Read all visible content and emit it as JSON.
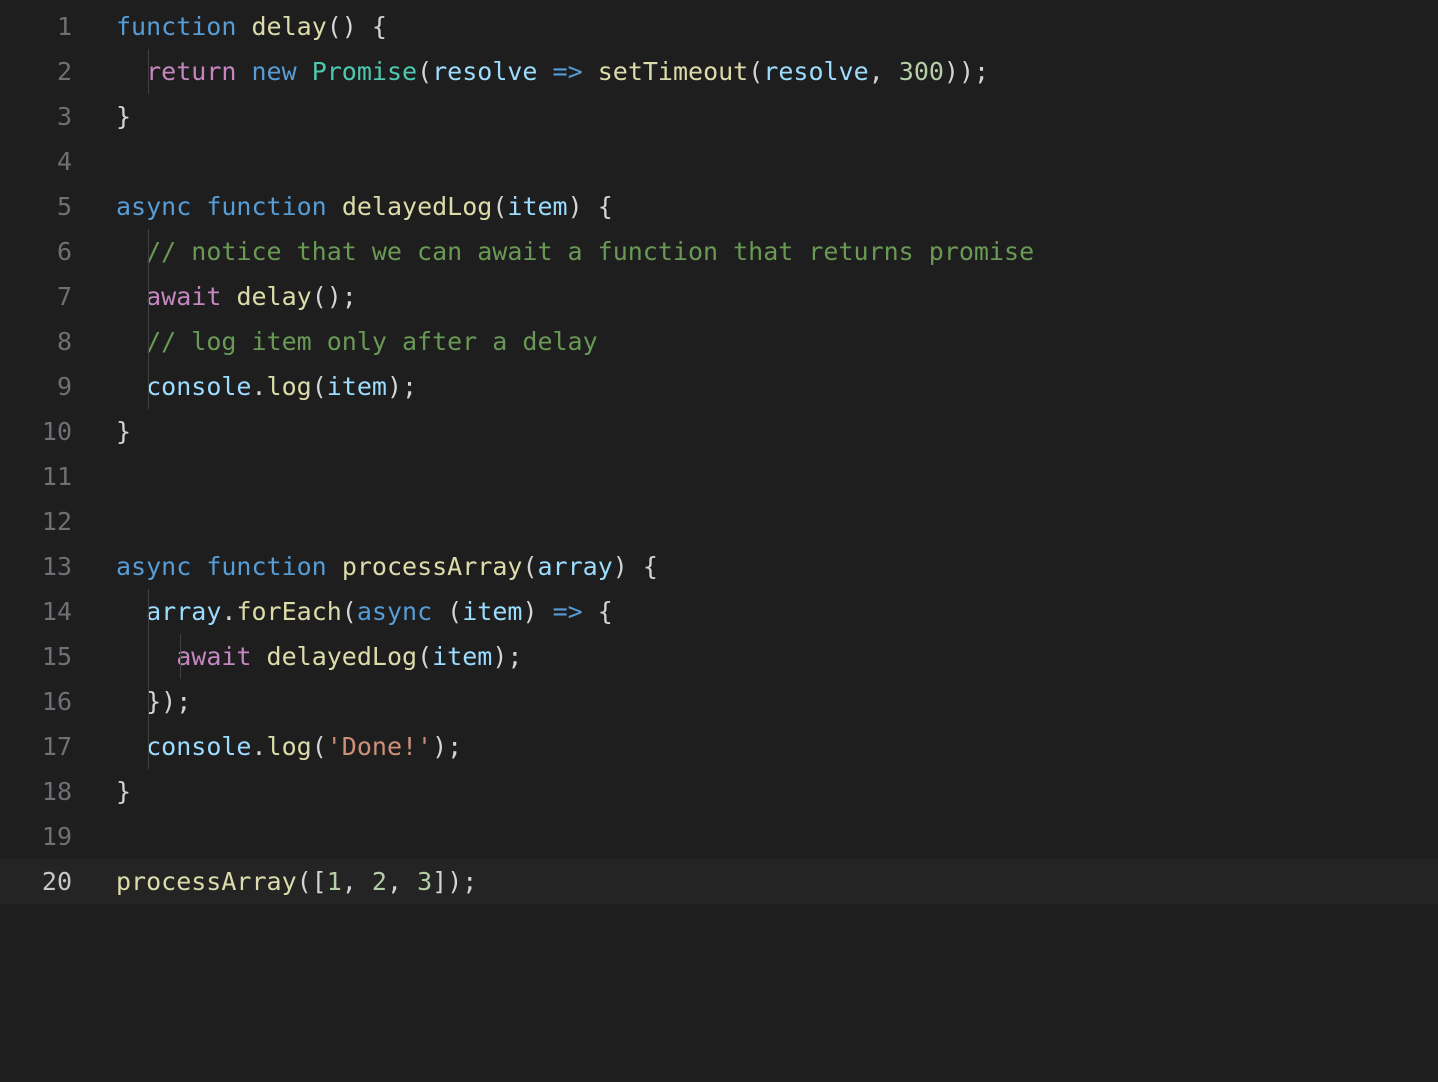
{
  "editor": {
    "activeLine": 20,
    "lines": [
      {
        "n": 1,
        "indent": 0,
        "tokens": [
          [
            "kw",
            "function"
          ],
          [
            "punc",
            " "
          ],
          [
            "fn",
            "delay"
          ],
          [
            "punc",
            "() {"
          ]
        ]
      },
      {
        "n": 2,
        "indent": 1,
        "tokens": [
          [
            "ctrl",
            "return"
          ],
          [
            "punc",
            " "
          ],
          [
            "kw",
            "new"
          ],
          [
            "punc",
            " "
          ],
          [
            "cls",
            "Promise"
          ],
          [
            "punc",
            "("
          ],
          [
            "var",
            "resolve"
          ],
          [
            "punc",
            " "
          ],
          [
            "kw",
            "=>"
          ],
          [
            "punc",
            " "
          ],
          [
            "fn",
            "setTimeout"
          ],
          [
            "punc",
            "("
          ],
          [
            "var",
            "resolve"
          ],
          [
            "punc",
            ", "
          ],
          [
            "num",
            "300"
          ],
          [
            "punc",
            "));"
          ]
        ]
      },
      {
        "n": 3,
        "indent": 0,
        "tokens": [
          [
            "punc",
            "}"
          ]
        ]
      },
      {
        "n": 4,
        "indent": 0,
        "tokens": []
      },
      {
        "n": 5,
        "indent": 0,
        "tokens": [
          [
            "kw",
            "async"
          ],
          [
            "punc",
            " "
          ],
          [
            "kw",
            "function"
          ],
          [
            "punc",
            " "
          ],
          [
            "fn",
            "delayedLog"
          ],
          [
            "punc",
            "("
          ],
          [
            "var",
            "item"
          ],
          [
            "punc",
            ") {"
          ]
        ]
      },
      {
        "n": 6,
        "indent": 1,
        "tokens": [
          [
            "cmt",
            "// notice that we can await a function that returns promise"
          ]
        ]
      },
      {
        "n": 7,
        "indent": 1,
        "tokens": [
          [
            "ctrl",
            "await"
          ],
          [
            "punc",
            " "
          ],
          [
            "fn",
            "delay"
          ],
          [
            "punc",
            "();"
          ]
        ]
      },
      {
        "n": 8,
        "indent": 1,
        "tokens": [
          [
            "cmt",
            "// log item only after a delay"
          ]
        ]
      },
      {
        "n": 9,
        "indent": 1,
        "tokens": [
          [
            "var",
            "console"
          ],
          [
            "punc",
            "."
          ],
          [
            "fn",
            "log"
          ],
          [
            "punc",
            "("
          ],
          [
            "var",
            "item"
          ],
          [
            "punc",
            ");"
          ]
        ]
      },
      {
        "n": 10,
        "indent": 0,
        "tokens": [
          [
            "punc",
            "}"
          ]
        ]
      },
      {
        "n": 11,
        "indent": 0,
        "tokens": []
      },
      {
        "n": 12,
        "indent": 0,
        "tokens": []
      },
      {
        "n": 13,
        "indent": 0,
        "tokens": [
          [
            "kw",
            "async"
          ],
          [
            "punc",
            " "
          ],
          [
            "kw",
            "function"
          ],
          [
            "punc",
            " "
          ],
          [
            "fn",
            "processArray"
          ],
          [
            "punc",
            "("
          ],
          [
            "var",
            "array"
          ],
          [
            "punc",
            ") {"
          ]
        ]
      },
      {
        "n": 14,
        "indent": 1,
        "tokens": [
          [
            "var",
            "array"
          ],
          [
            "punc",
            "."
          ],
          [
            "fn",
            "forEach"
          ],
          [
            "punc",
            "("
          ],
          [
            "kw",
            "async"
          ],
          [
            "punc",
            " ("
          ],
          [
            "var",
            "item"
          ],
          [
            "punc",
            ") "
          ],
          [
            "kw",
            "=>"
          ],
          [
            "punc",
            " {"
          ]
        ]
      },
      {
        "n": 15,
        "indent": 2,
        "tokens": [
          [
            "ctrl",
            "await"
          ],
          [
            "punc",
            " "
          ],
          [
            "fn",
            "delayedLog"
          ],
          [
            "punc",
            "("
          ],
          [
            "var",
            "item"
          ],
          [
            "punc",
            ");"
          ]
        ]
      },
      {
        "n": 16,
        "indent": 1,
        "tokens": [
          [
            "punc",
            "});"
          ]
        ]
      },
      {
        "n": 17,
        "indent": 1,
        "tokens": [
          [
            "var",
            "console"
          ],
          [
            "punc",
            "."
          ],
          [
            "fn",
            "log"
          ],
          [
            "punc",
            "("
          ],
          [
            "str",
            "'Done!'"
          ],
          [
            "punc",
            ");"
          ]
        ]
      },
      {
        "n": 18,
        "indent": 0,
        "tokens": [
          [
            "punc",
            "}"
          ]
        ]
      },
      {
        "n": 19,
        "indent": 0,
        "tokens": []
      },
      {
        "n": 20,
        "indent": 0,
        "tokens": [
          [
            "fn",
            "processArray"
          ],
          [
            "punc",
            "(["
          ],
          [
            "num",
            "1"
          ],
          [
            "punc",
            ", "
          ],
          [
            "num",
            "2"
          ],
          [
            "punc",
            ", "
          ],
          [
            "num",
            "3"
          ],
          [
            "punc",
            "]);"
          ]
        ]
      }
    ]
  }
}
